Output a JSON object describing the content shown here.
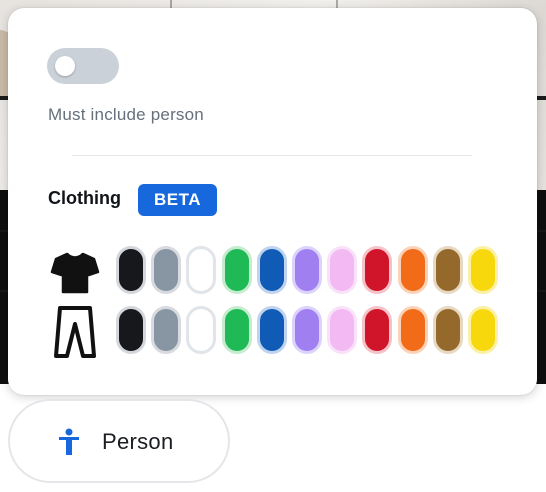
{
  "filter_panel": {
    "toggle_label": "Must include person",
    "toggle_on": false,
    "clothing_title": "Clothing",
    "beta_badge": "BETA",
    "colors": [
      "#16181c",
      "#8895a3",
      "#ffffff",
      "#1fb955",
      "#0f5bb5",
      "#a07ff0",
      "#f3b9f2",
      "#d0152b",
      "#f26b18",
      "#94692b",
      "#f7d80d"
    ],
    "color_borders": [
      "#d3d7dc",
      "#d7dbe0",
      "#e1e4e8",
      "#c6eccf",
      "#bfd3ee",
      "#dcd3fb",
      "#f9e2f9",
      "#f4c3c9",
      "#fbd2b7",
      "#e7d8c2",
      "#fbf0a6"
    ],
    "rows": [
      {
        "garment": "shirt-icon"
      },
      {
        "garment": "pants-icon"
      }
    ]
  },
  "person_button": {
    "label": "Person",
    "icon": "person-icon",
    "icon_color": "#1668dc"
  }
}
